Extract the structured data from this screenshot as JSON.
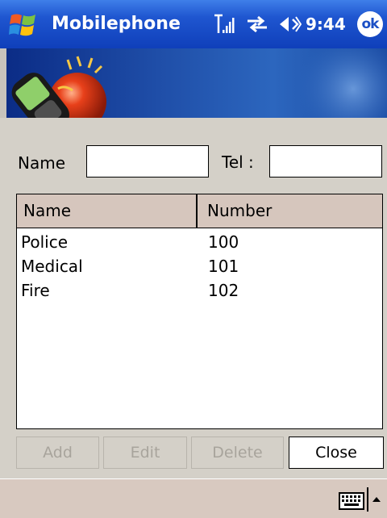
{
  "titlebar": {
    "app_title": "Mobilephone",
    "clock": "9:44",
    "ok_label": "ok",
    "icons": [
      "windows-start-icon",
      "signal-strength-icon",
      "sync-connection-icon",
      "volume-icon"
    ],
    "colors": {
      "bar": "#1f56d0",
      "text": "#ffffff"
    }
  },
  "form": {
    "name_label": "Name",
    "tel_label": "Tel :",
    "name_value": "",
    "tel_value": ""
  },
  "list": {
    "columns": [
      "Name",
      "Number"
    ],
    "rows": [
      {
        "name": "Police",
        "number": "100"
      },
      {
        "name": "Medical",
        "number": "101"
      },
      {
        "name": "Fire",
        "number": "102"
      }
    ],
    "header_color": "#d6c6bd"
  },
  "buttons": {
    "add": "Add",
    "edit": "Edit",
    "delete": "Delete",
    "close": "Close",
    "disabled_text_color": "#a8a49c"
  },
  "menubar": {
    "icons": [
      "keyboard-icon",
      "sip-arrow-up-icon"
    ],
    "color": "#d8c9c0"
  }
}
